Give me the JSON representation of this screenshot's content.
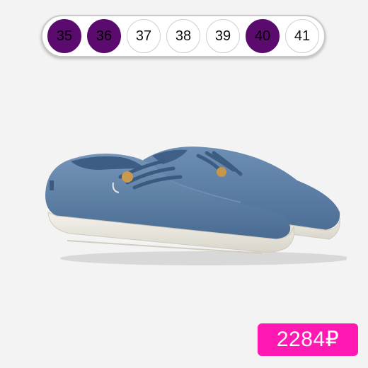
{
  "sizes": [
    {
      "label": "35",
      "available": false
    },
    {
      "label": "36",
      "available": false
    },
    {
      "label": "37",
      "available": true
    },
    {
      "label": "38",
      "available": true
    },
    {
      "label": "39",
      "available": true
    },
    {
      "label": "40",
      "available": false
    },
    {
      "label": "41",
      "available": true
    }
  ],
  "price": {
    "text": "2284₽"
  },
  "colors": {
    "unavailable_fill": "#5b0a6e",
    "price_badge": "#ff18b2",
    "shoe_canvas": "#5a7fa6",
    "sole": "#ece9e0"
  },
  "product_image": {
    "icon": "blue-slip-on-shoes-image"
  }
}
